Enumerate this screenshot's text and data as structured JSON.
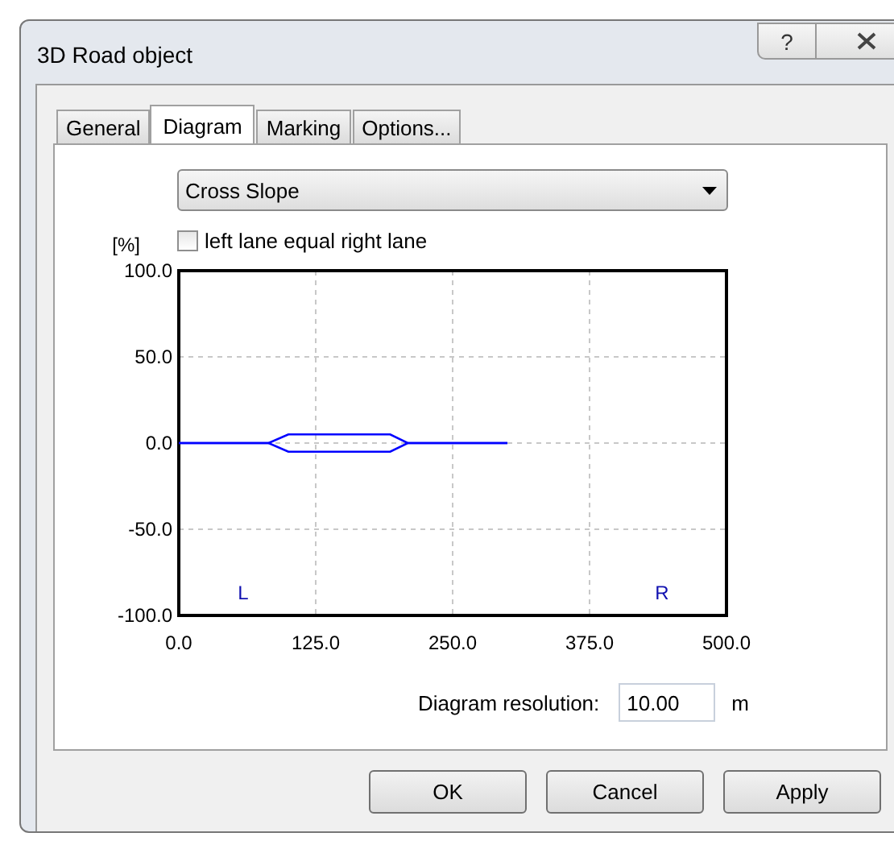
{
  "window": {
    "title": "3D Road object",
    "help_button": "?"
  },
  "tabs": [
    {
      "label": "General",
      "selected": false
    },
    {
      "label": "Diagram",
      "selected": true
    },
    {
      "label": "Marking",
      "selected": false
    },
    {
      "label": "Options...",
      "selected": false
    }
  ],
  "diagram_type": {
    "value": "Cross Slope"
  },
  "checkbox": {
    "label": "left lane equal right lane",
    "checked": false
  },
  "chart_data": {
    "type": "line",
    "ylabel": "[%]",
    "x": [
      0,
      82,
      100,
      193,
      209,
      300
    ],
    "series": [
      {
        "color": "#0000ff",
        "values": [
          0,
          0,
          5,
          5,
          0,
          0
        ]
      },
      {
        "color": "#0000ff",
        "values": [
          0,
          0,
          -5,
          -5,
          0,
          0
        ]
      }
    ],
    "xlim": [
      0,
      500
    ],
    "ylim": [
      -100,
      100
    ],
    "xticks": [
      {
        "value": 0,
        "label": "0.0"
      },
      {
        "value": 125,
        "label": "125.0"
      },
      {
        "value": 250,
        "label": "250.0"
      },
      {
        "value": 375,
        "label": "375.0"
      },
      {
        "value": 500,
        "label": "500.0"
      }
    ],
    "yticks": [
      {
        "value": 100,
        "label": "100.0"
      },
      {
        "value": 50,
        "label": "50.0"
      },
      {
        "value": 0,
        "label": "0.0"
      },
      {
        "value": -50,
        "label": "-50.0"
      },
      {
        "value": -100,
        "label": "-100.0"
      }
    ],
    "grid": true,
    "annotations": [
      "L",
      "R"
    ]
  },
  "resolution": {
    "label": "Diagram resolution:",
    "value": "10.00",
    "unit": "m"
  },
  "buttons": [
    "OK",
    "Cancel",
    "Apply"
  ]
}
